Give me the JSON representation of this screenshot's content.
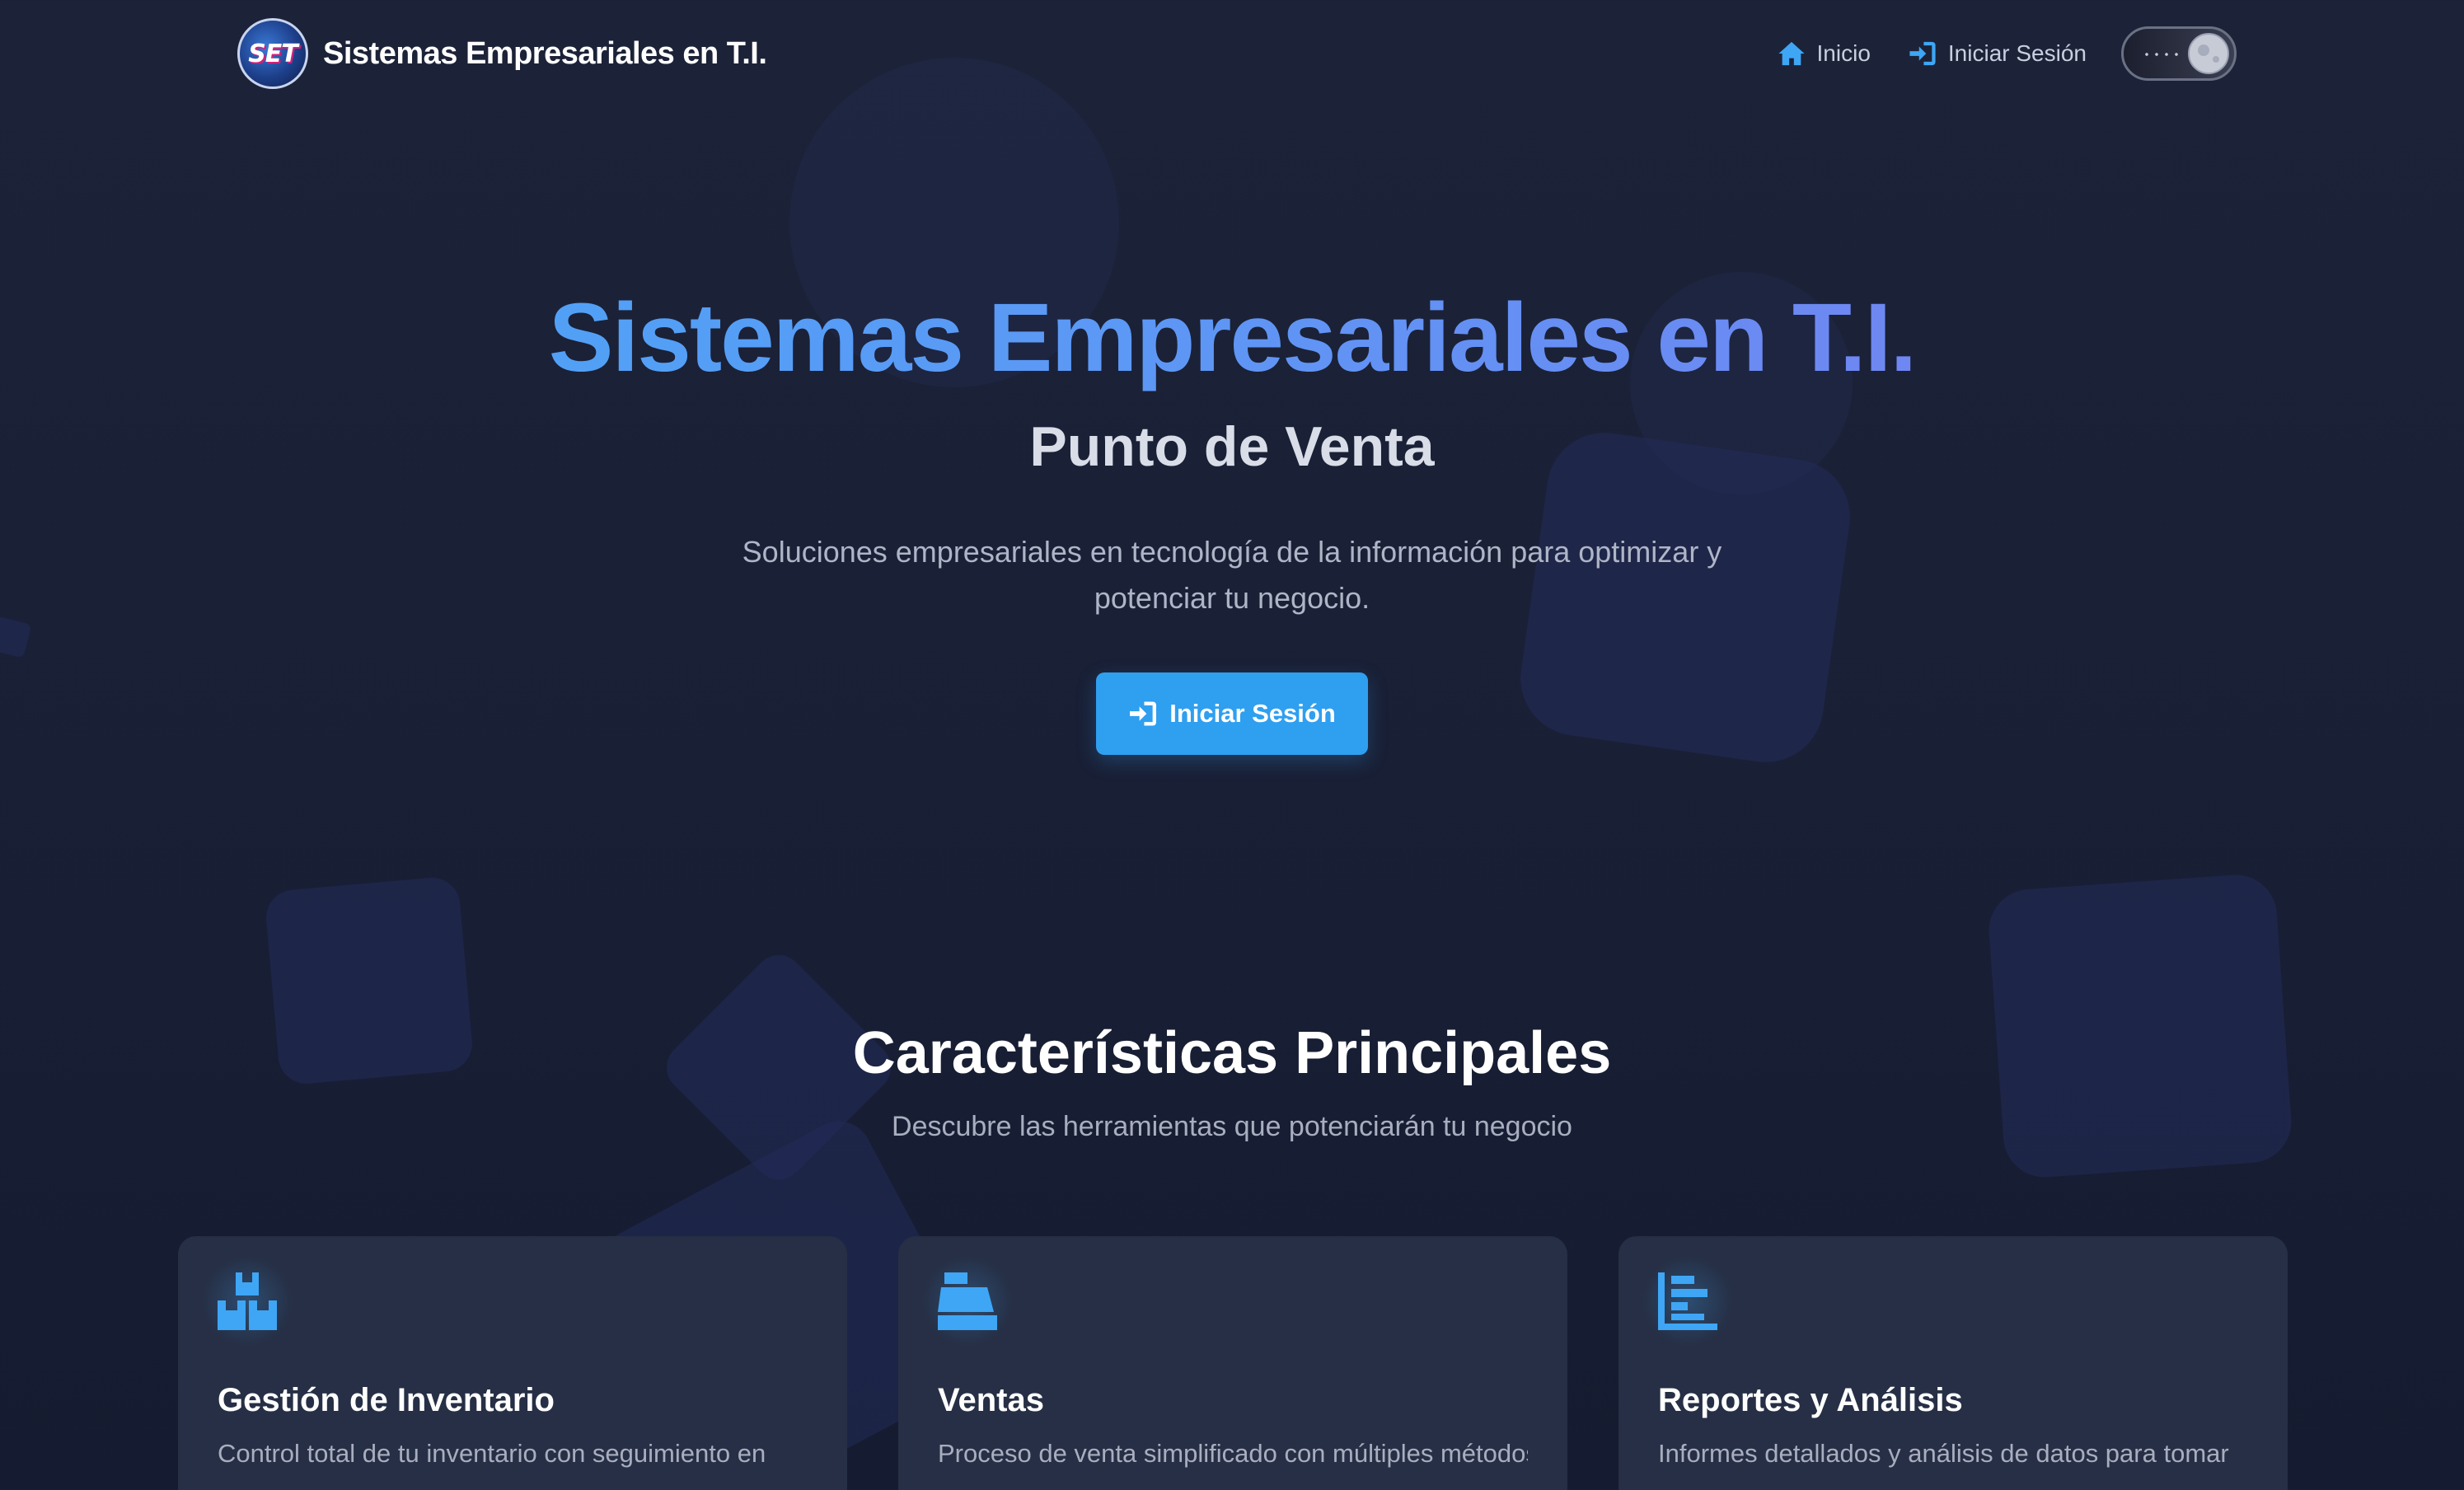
{
  "navbar": {
    "logo_text": "SET",
    "brand": "Sistemas Empresariales en T.I.",
    "links": [
      {
        "label": "Inicio",
        "icon": "home-icon"
      },
      {
        "label": "Iniciar Sesión",
        "icon": "sign-in-icon"
      }
    ],
    "theme_toggle": "dark-mode"
  },
  "hero": {
    "title": "Sistemas Empresariales en T.I.",
    "subtitle": "Punto de Venta",
    "description": "Soluciones empresariales en tecnología de la información para optimizar y potenciar tu negocio.",
    "cta_label": "Iniciar Sesión"
  },
  "features": {
    "title": "Características Principales",
    "subtitle": "Descubre las herramientas que potenciarán tu negocio",
    "cards": [
      {
        "icon": "boxes-icon",
        "title": "Gestión de Inventario",
        "text": "Control total de tu inventario con seguimiento en"
      },
      {
        "icon": "cash-register-icon",
        "title": "Ventas",
        "text": "Proceso de venta simplificado con múltiples métodos"
      },
      {
        "icon": "chart-icon",
        "title": "Reportes y Análisis",
        "text": "Informes detallados y análisis de datos para tomar"
      }
    ]
  },
  "colors": {
    "accent": "#3ea6f5",
    "background": "#1a2036",
    "card": "#262f45",
    "gradient_start": "#47a9f7",
    "gradient_end": "#7b7bf0"
  }
}
